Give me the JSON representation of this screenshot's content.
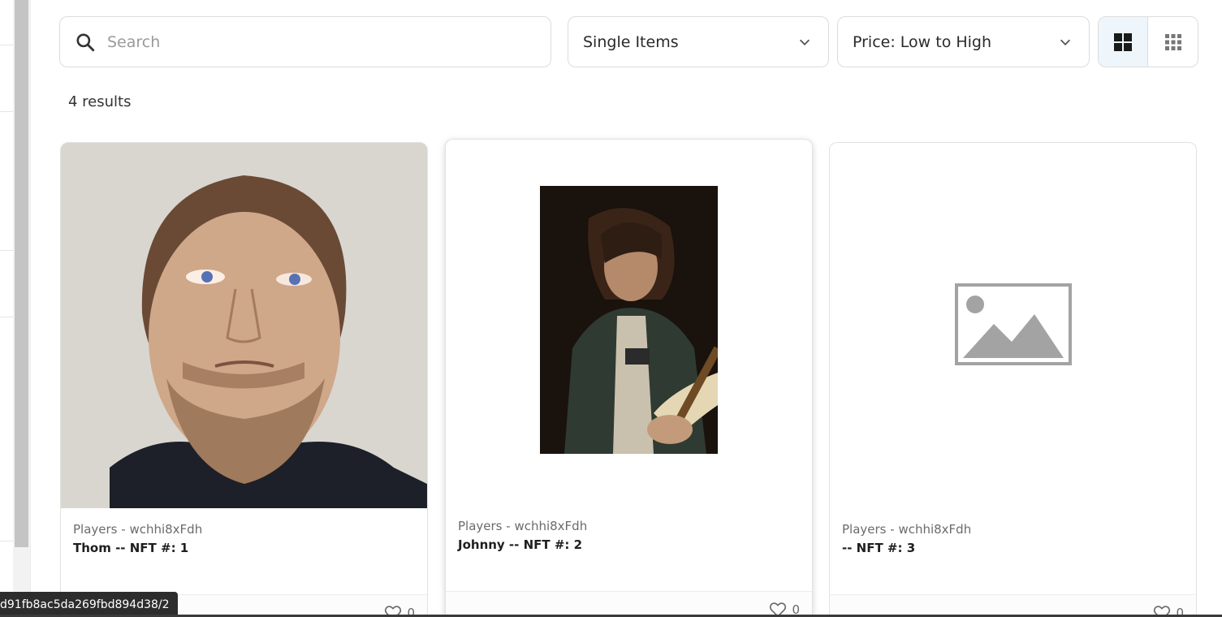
{
  "search": {
    "placeholder": "Search"
  },
  "filters": {
    "type_value": "Single Items",
    "sort_value": "Price: Low to High"
  },
  "results_text": "4 results",
  "cards": [
    {
      "collection": "Players - wchhi8xFdh",
      "name": "Thom -- NFT #: 1",
      "likes": "0"
    },
    {
      "collection": "Players - wchhi8xFdh",
      "name": "Johnny -- NFT #: 2",
      "likes": "0"
    },
    {
      "collection": "Players - wchhi8xFdh",
      "name": "-- NFT #: 3",
      "likes": "0"
    }
  ],
  "status_url": "d91fb8ac5da269fbd894d38/2",
  "colors": {
    "accent_bg": "#eef6fc",
    "border": "#dcdcdc",
    "status_bg": "#2d2d2d"
  }
}
